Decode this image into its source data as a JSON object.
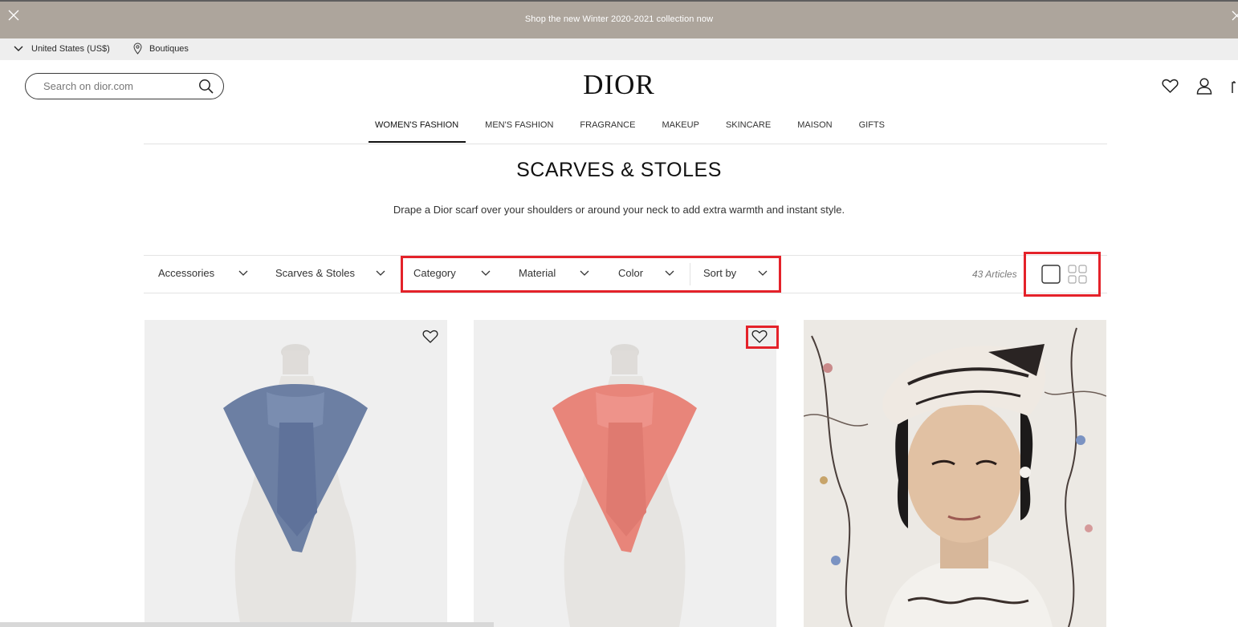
{
  "promo": {
    "text": "Shop the new Winter 2020-2021 collection now"
  },
  "utility": {
    "country": "United States (US$)",
    "boutiques": "Boutiques"
  },
  "header": {
    "search_placeholder": "Search on dior.com",
    "logo": "DIOR",
    "icons": [
      "heart-icon",
      "user-icon",
      "bag-icon"
    ]
  },
  "nav": {
    "tabs": [
      {
        "label": "WOMEN'S FASHION",
        "active": true
      },
      {
        "label": "MEN'S FASHION"
      },
      {
        "label": "FRAGRANCE"
      },
      {
        "label": "MAKEUP"
      },
      {
        "label": "SKINCARE"
      },
      {
        "label": "MAISON"
      },
      {
        "label": "GIFTS"
      }
    ]
  },
  "page": {
    "title": "SCARVES & STOLES",
    "description": "Drape a Dior scarf over your shoulders or around your neck to add extra warmth and instant style."
  },
  "filters": {
    "accessories": "Accessories",
    "scarves": "Scarves & Stoles",
    "category": "Category",
    "material": "Material",
    "color": "Color",
    "sort_by": "Sort by",
    "count": "43 Articles"
  },
  "colors": {
    "promo_bg": "#ada59c",
    "highlight": "#e4222a",
    "scarf_blue": "#6c7fa3",
    "scarf_pink": "#e8857a"
  },
  "products": [
    {
      "type": "scarf",
      "color": "blue"
    },
    {
      "type": "scarf",
      "color": "pink"
    },
    {
      "type": "editorial photo"
    }
  ]
}
